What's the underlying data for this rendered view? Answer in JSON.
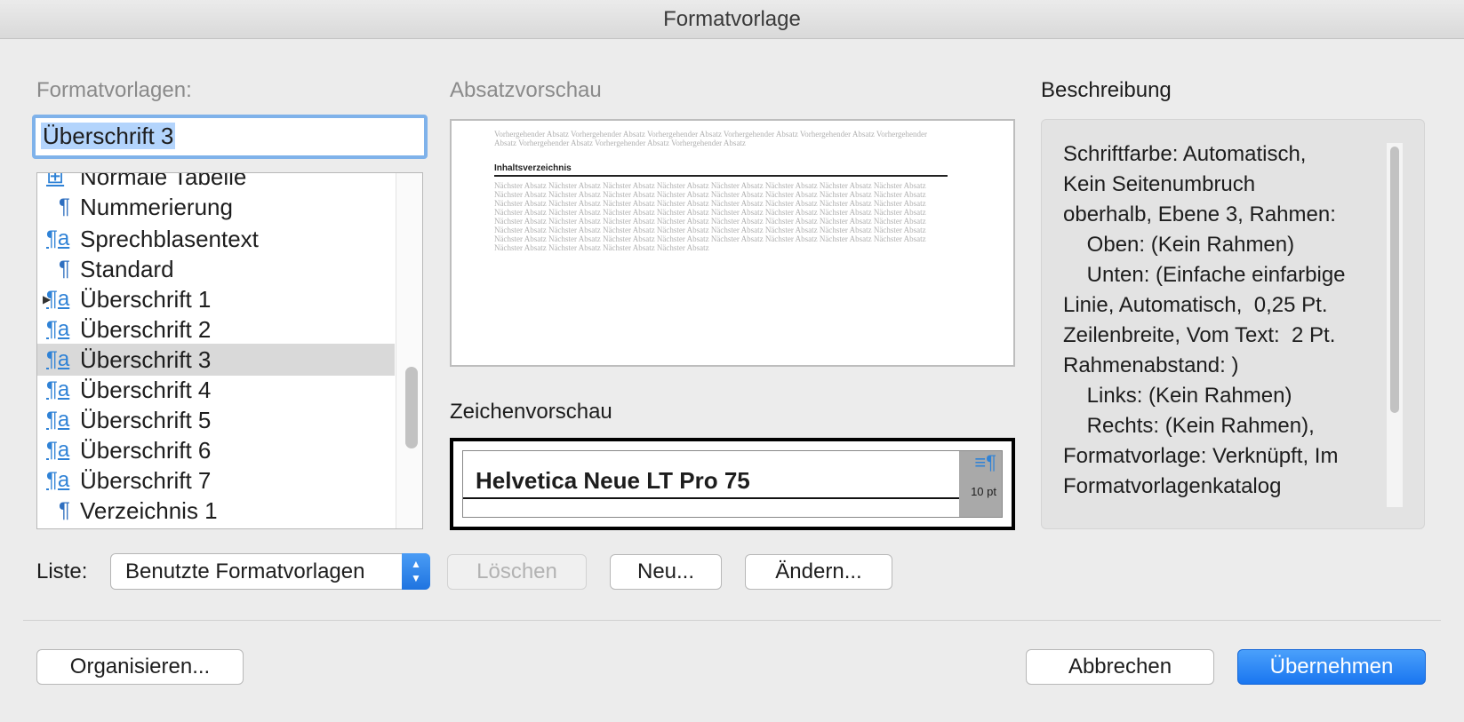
{
  "window": {
    "title": "Formatvorlage"
  },
  "left": {
    "label": "Formatvorlagen:",
    "name_value": "Überschrift 3",
    "list": [
      {
        "icon": "table-icon",
        "glyph": "⊞",
        "name": "Normale Tabelle"
      },
      {
        "icon": "pilcrow-icon",
        "glyph": "¶",
        "name": "Nummerierung"
      },
      {
        "icon": "linked-style-icon",
        "glyph": "¶a",
        "name": "Sprechblasentext"
      },
      {
        "icon": "pilcrow-icon",
        "glyph": "¶",
        "name": "Standard"
      },
      {
        "icon": "linked-style-icon",
        "glyph": "¶a",
        "name": "Überschrift 1"
      },
      {
        "icon": "linked-style-icon",
        "glyph": "¶a",
        "name": "Überschrift 2"
      },
      {
        "icon": "linked-style-icon",
        "glyph": "¶a",
        "name": "Überschrift 3"
      },
      {
        "icon": "linked-style-icon",
        "glyph": "¶a",
        "name": "Überschrift 4"
      },
      {
        "icon": "linked-style-icon",
        "glyph": "¶a",
        "name": "Überschrift 5"
      },
      {
        "icon": "linked-style-icon",
        "glyph": "¶a",
        "name": "Überschrift 6"
      },
      {
        "icon": "linked-style-icon",
        "glyph": "¶a",
        "name": "Überschrift 7"
      },
      {
        "icon": "pilcrow-icon",
        "glyph": "¶",
        "name": "Verzeichnis 1"
      }
    ],
    "selected_index": 6
  },
  "preview": {
    "label": "Absatzvorschau",
    "previous_text": "Vorhergehender Absatz Vorhergehender Absatz Vorhergehender Absatz Vorhergehender Absatz Vorhergehender Absatz Vorhergehender Absatz Vorhergehender Absatz Vorhergehender Absatz Vorhergehender Absatz",
    "heading_text": "Inhaltsverzeichnis",
    "next_text": "Nächster Absatz Nächster Absatz Nächster Absatz Nächster Absatz Nächster Absatz Nächster Absatz Nächster Absatz Nächster Absatz Nächster Absatz Nächster Absatz Nächster Absatz Nächster Absatz Nächster Absatz Nächster Absatz Nächster Absatz Nächster Absatz Nächster Absatz Nächster Absatz Nächster Absatz Nächster Absatz Nächster Absatz Nächster Absatz Nächster Absatz Nächster Absatz Nächster Absatz Nächster Absatz Nächster Absatz Nächster Absatz Nächster Absatz Nächster Absatz Nächster Absatz Nächster Absatz Nächster Absatz Nächster Absatz Nächster Absatz Nächster Absatz Nächster Absatz Nächster Absatz Nächster Absatz Nächster Absatz Nächster Absatz Nächster Absatz Nächster Absatz Nächster Absatz Nächster Absatz Nächster Absatz Nächster Absatz Nächster Absatz Nächster Absatz Nächster Absatz Nächster Absatz Nächster Absatz Nächster Absatz Nächster Absatz Nächster Absatz Nächster Absatz Nächster Absatz Nächster Absatz Nächster Absatz Nächster Absatz"
  },
  "char_preview": {
    "label": "Zeichenvorschau",
    "sample": "Helvetica Neue LT Pro 75",
    "side_symbol": "≡¶",
    "size": "10 pt"
  },
  "description": {
    "label": "Beschreibung",
    "text": "Schriftfarbe: Automatisch,\nKein Seitenumbruch\noberhalb, Ebene 3, Rahmen:\n    Oben: (Kein Rahmen)\n    Unten: (Einfache einfarbige\nLinie, Automatisch,  0,25 Pt.\nZeilenbreite, Vom Text:  2 Pt.\nRahmenabstand: )\n    Links: (Kein Rahmen)\n    Rechts: (Kein Rahmen),\nFormatvorlage: Verknüpft, Im\nFormatvorlagenkatalog"
  },
  "bottom": {
    "list_label": "Liste:",
    "list_value": "Benutzte Formatvorlagen",
    "delete": "Löschen",
    "new": "Neu...",
    "modify": "Ändern...",
    "organize": "Organisieren...",
    "cancel": "Abbrechen",
    "apply": "Übernehmen"
  },
  "colors": {
    "accent": "#1a76f0",
    "selection": "#b3d4fc",
    "icon_blue": "#2f82d6"
  }
}
